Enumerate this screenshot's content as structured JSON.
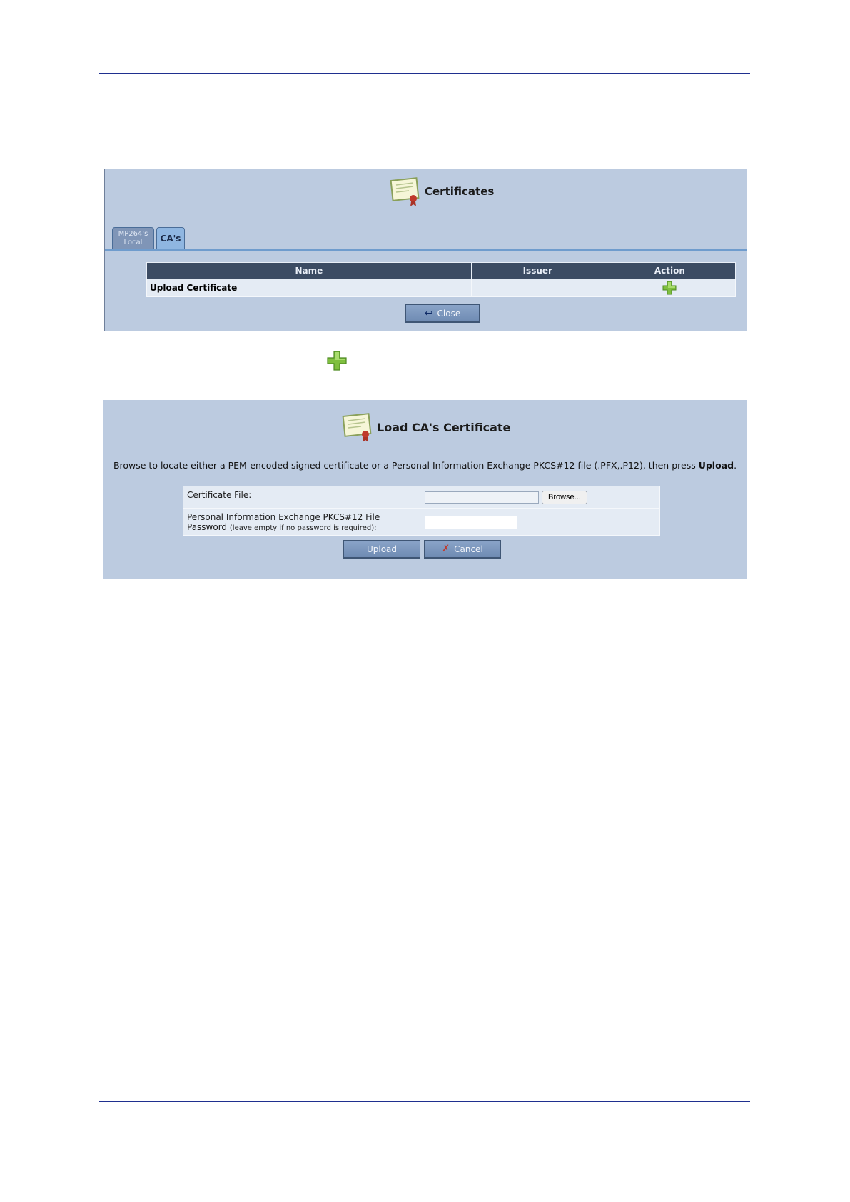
{
  "certificates_panel": {
    "title": "Certificates",
    "tabs": [
      {
        "label_line1": "MP264's",
        "label_line2": "Local"
      },
      {
        "label": "CA's"
      }
    ],
    "table": {
      "headers": [
        "Name",
        "Issuer",
        "Action"
      ],
      "rows": [
        {
          "name": "Upload Certificate",
          "issuer": "",
          "action_icon": "plus-icon"
        }
      ]
    },
    "close_label": "Close"
  },
  "load_panel": {
    "title": "Load CA's Certificate",
    "desc_prefix": "Browse to locate either a PEM-encoded signed certificate or a Personal Information Exchange PKCS#12 file (.PFX,.P12), then press ",
    "desc_bold": "Upload",
    "desc_suffix": ".",
    "certificate_file_label": "Certificate File:",
    "browse_label": "Browse...",
    "password_label_line1": "Personal Information Exchange PKCS#12 File",
    "password_label_line2": "Password",
    "password_hint": "(leave empty if no password is required):",
    "upload_label": "Upload",
    "cancel_label": "Cancel"
  },
  "colors": {
    "panel_bg": "#bccbe0",
    "header_bg": "#3b4b63",
    "rule": "#1f2f8f"
  }
}
